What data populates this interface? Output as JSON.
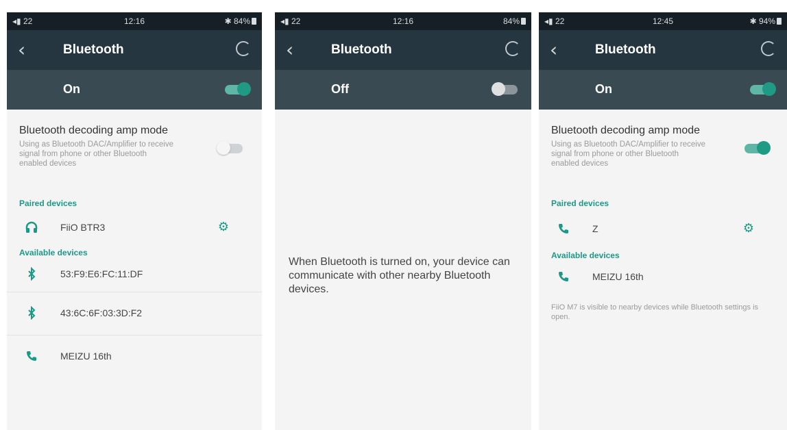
{
  "panels": [
    {
      "status": {
        "signal": "◂▮ 22",
        "time": "12:16",
        "battery": "✱ 84%"
      },
      "title": "Bluetooth",
      "bt_state": "On",
      "amp_title": "Bluetooth decoding amp mode",
      "amp_desc": "Using as Bluetooth DAC/Amplifier to receive signal from phone or other Bluetooth enabled devices",
      "paired_label": "Paired devices",
      "paired": [
        {
          "name": "FiiO BTR3",
          "icon": "headphones-icon"
        }
      ],
      "available_label": "Available devices",
      "available": [
        {
          "name": "53:F9:E6:FC:11:DF",
          "icon": "bluetooth-icon"
        },
        {
          "name": "43:6C:6F:03:3D:F2",
          "icon": "bluetooth-icon"
        },
        {
          "name": "MEIZU 16th",
          "icon": "phone-icon"
        }
      ]
    },
    {
      "status": {
        "signal": "◂▮ 22",
        "time": "12:16",
        "battery": "84%"
      },
      "title": "Bluetooth",
      "bt_state": "Off",
      "message": "When Bluetooth is turned on, your device can communicate with other nearby Bluetooth devices."
    },
    {
      "status": {
        "signal": "◂▮ 22",
        "time": "12:45",
        "battery": "✱ 94%"
      },
      "title": "Bluetooth",
      "bt_state": "On",
      "amp_title": "Bluetooth decoding amp mode",
      "amp_desc": "Using as Bluetooth DAC/Amplifier to receive signal from phone or other Bluetooth enabled devices",
      "paired_label": "Paired devices",
      "paired": [
        {
          "name": "Z",
          "icon": "phone-icon"
        }
      ],
      "available_label": "Available devices",
      "available": [
        {
          "name": "MEIZU 16th",
          "icon": "phone-icon"
        }
      ],
      "visibility_note": "FiiO M7 is visible to nearby devices while Bluetooth settings is open."
    }
  ],
  "colors": {
    "accent": "#1a9a86",
    "toolbar": "#263640",
    "statusbar": "#161f26",
    "switchbar": "#3a4a53"
  }
}
